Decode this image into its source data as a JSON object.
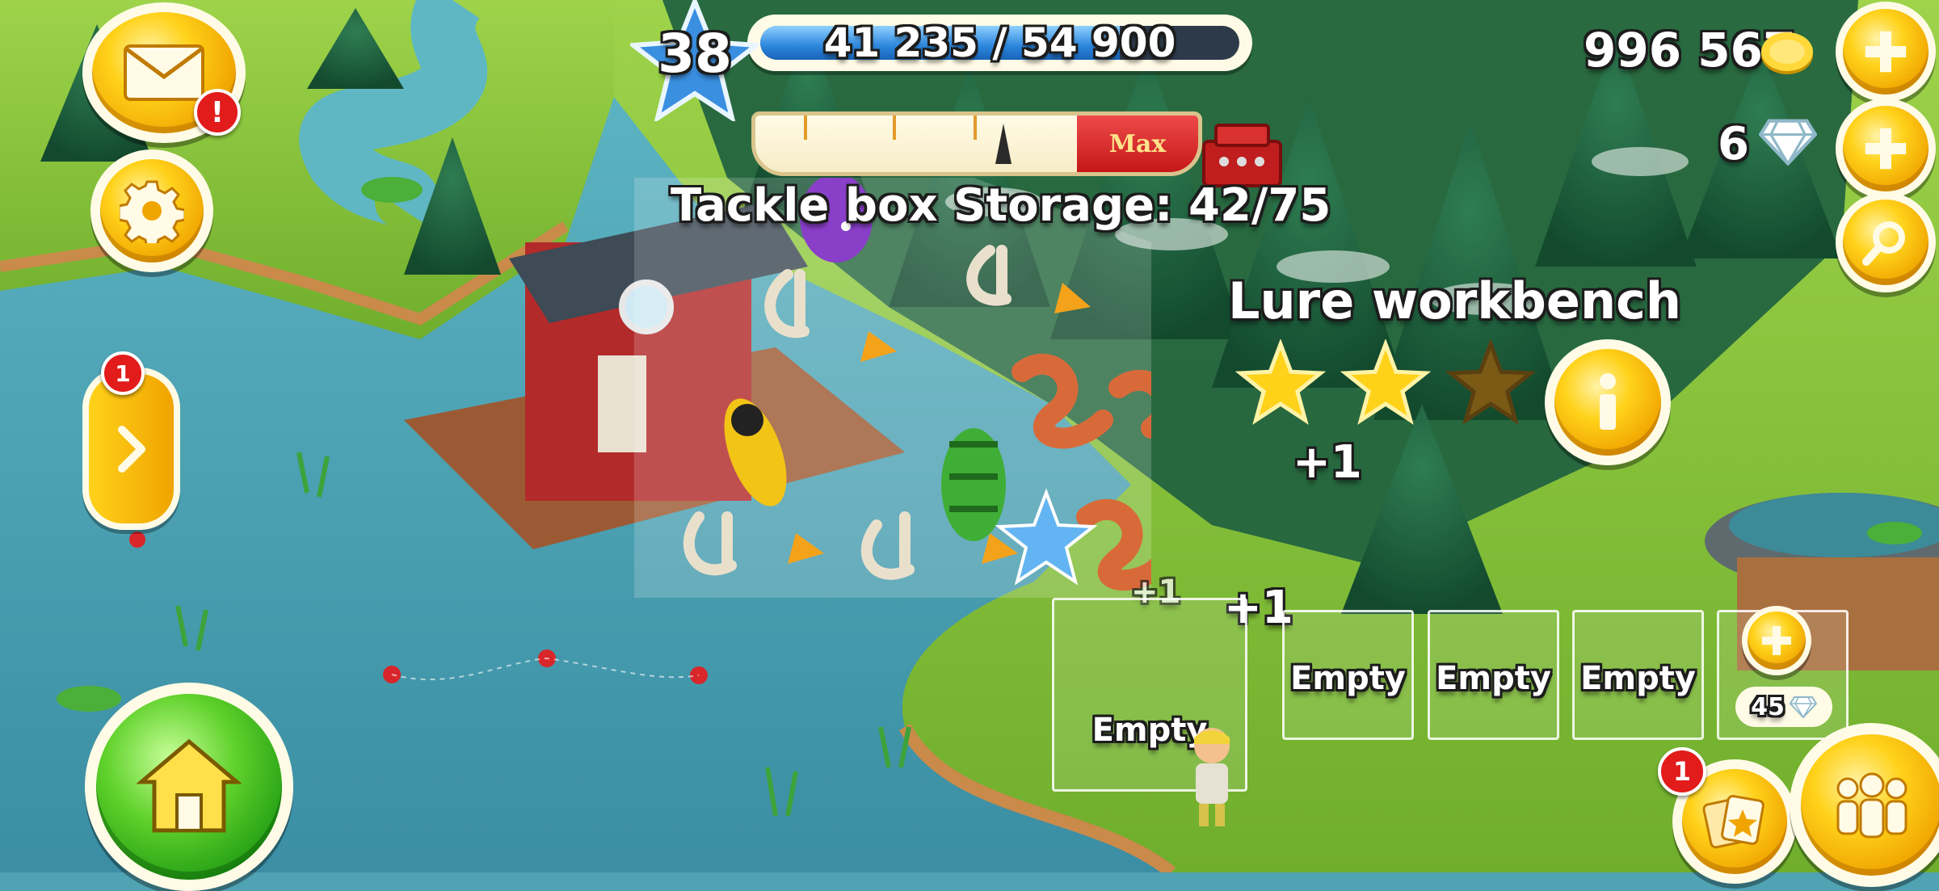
{
  "player": {
    "level": "38",
    "xp_text": "41 235 / 54 900",
    "xp_fraction": 0.751
  },
  "currency": {
    "coins": "996 567",
    "diamonds": "6"
  },
  "storage": {
    "title": "Tackle box Storage: 42/75",
    "max_label": "Max",
    "fill_fraction": 0.56
  },
  "building": {
    "title": "Lure workbench",
    "stars_total": 3,
    "stars_filled": 2
  },
  "production": {
    "plus_labels": [
      "+1",
      "+1",
      "+1"
    ],
    "slots": [
      {
        "label": "Empty",
        "kind": "empty"
      },
      {
        "label": "Empty",
        "kind": "empty"
      },
      {
        "label": "Empty",
        "kind": "empty"
      },
      {
        "label": "Empty",
        "kind": "empty"
      },
      {
        "label": "",
        "kind": "locked"
      }
    ],
    "unlock_cost": "45"
  },
  "notifications": {
    "mail_badge": "!",
    "side_panel_badge": "1",
    "cards_badge": "1"
  },
  "icons": {
    "mail": "envelope-icon",
    "settings": "gear-icon",
    "home": "house-icon",
    "search": "magnifier-icon",
    "friends": "people-icon",
    "cards": "cards-icon",
    "coin": "coin-icon",
    "diamond": "diamond-icon",
    "info": "info-icon"
  },
  "colors": {
    "gold": "#ffd21a",
    "xp_blue": "#2b86dd",
    "badge_red": "#e21b1b",
    "water": "#4fa3b3",
    "grass": "#8cc63f"
  }
}
